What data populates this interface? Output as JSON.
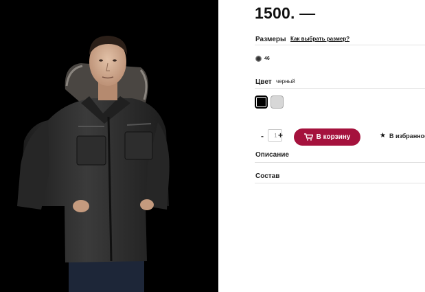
{
  "product": {
    "image_alt": "Man wearing a black winter parka with fur-trimmed hood",
    "price": "1500. —"
  },
  "sizes": {
    "label": "Размеры",
    "guide_link": "Как выбрать размер?",
    "options": [
      "46"
    ]
  },
  "color": {
    "label": "Цвет",
    "value": "черный",
    "swatches": [
      {
        "name": "black",
        "color": "#000000"
      },
      {
        "name": "light-gray",
        "color": "#d7d7d7"
      }
    ]
  },
  "quantity": {
    "minus": "-",
    "value": "1",
    "plus": "+"
  },
  "actions": {
    "cart_label": "В корзину",
    "cart_color": "#a5123d",
    "favorite_label": "В избранное"
  },
  "sections": {
    "description": "Описание",
    "composition": "Состав"
  }
}
